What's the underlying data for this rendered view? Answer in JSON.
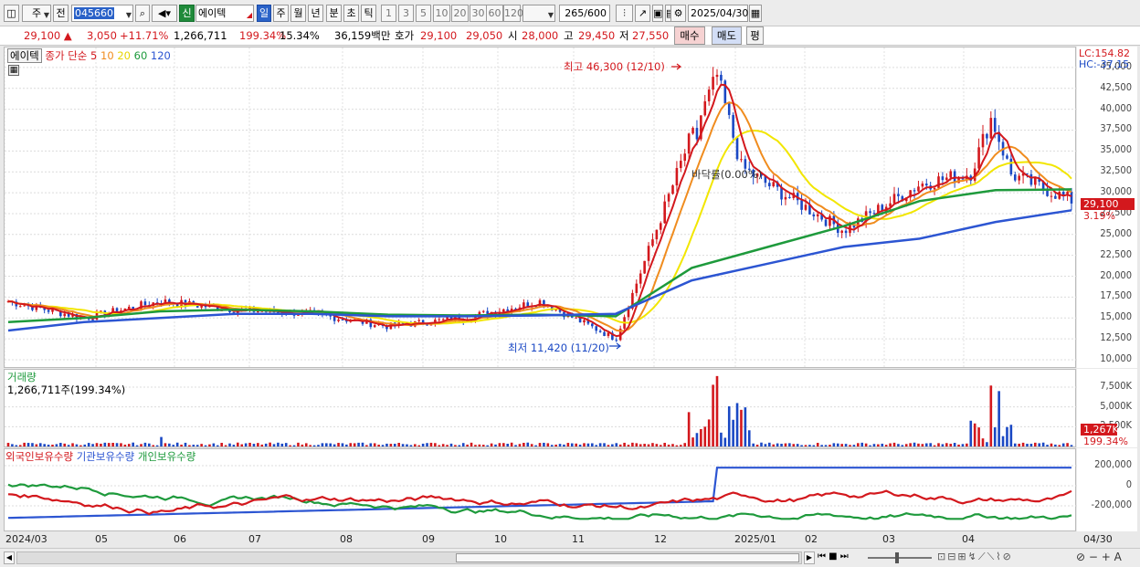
{
  "toolbar": {
    "market": "주",
    "prev": "전",
    "code": "045660",
    "new_badge": "신",
    "name": "에이텍",
    "periods": [
      "일",
      "주",
      "월",
      "년",
      "분",
      "초",
      "틱"
    ],
    "intervals": [
      "1",
      "3",
      "5",
      "10",
      "20",
      "30",
      "60",
      "120"
    ],
    "count": "265",
    "count_max": "/600",
    "date": "2025/04/30"
  },
  "quote": {
    "price": "29,100 ▲",
    "change": "3,050",
    "change_pct": "+11.71%",
    "volume": "1,266,711",
    "volume_ratio": "199.34%",
    "turnover": "15.34%",
    "amount": "36,159백만",
    "hoga_label": "호가",
    "hoga1": "29,100",
    "hoga2": "29,050",
    "open_label": "시",
    "open": "28,000",
    "high_label": "고",
    "high": "29,450",
    "low_label": "저",
    "low": "27,550",
    "buy": "매수",
    "sell": "매도",
    "eval": "평"
  },
  "price_panel": {
    "stock_label": "에이텍",
    "legend_prefix": "종가 단순",
    "ma_labels": [
      "5",
      "10",
      "20",
      "60",
      "120"
    ],
    "lc": "LC:154.82",
    "hc": "HC:-37.15",
    "high_note": "최고 46,300 (12/10)",
    "low_note": "최저 11,420 (11/20)",
    "bttm_note": "바닥률(0.00%)",
    "price_tag": "29,100",
    "pct_tag": "3.19%",
    "y_ticks": [
      "45,000",
      "42,500",
      "40,000",
      "37,500",
      "35,000",
      "32,500",
      "30,000",
      "27,500",
      "25,000",
      "22,500",
      "20,000",
      "17,500",
      "15,000",
      "12,500",
      "10,000"
    ]
  },
  "volume_panel": {
    "title": "거래량",
    "value": "1,266,711주(199.34%)",
    "y_ticks": [
      "7,500K",
      "5,000K",
      "2,500K"
    ],
    "tag_value": "1,267K",
    "tag_pct": "199.34%"
  },
  "holding_panel": {
    "labels": [
      "외국인보유수량",
      "기관보유수량",
      "개인보유수량"
    ],
    "y_ticks": [
      "200,000",
      "0",
      "-200,000"
    ]
  },
  "x_axis": {
    "labels": [
      "2024/03",
      "05",
      "06",
      "07",
      "08",
      "09",
      "10",
      "11",
      "12",
      "2025/01",
      "02",
      "03",
      "04"
    ],
    "end_label": "04/30"
  },
  "colors": {
    "up": "#d3181d",
    "down": "#1a48c4",
    "ma5": "#d3181d",
    "ma10": "#f08c1e",
    "ma20": "#f2e600",
    "ma60": "#1e9a3c",
    "ma120": "#2c55d2"
  },
  "chart_data": {
    "type": "line",
    "ylim": [
      10000,
      46300
    ],
    "x": [
      "2024/03",
      "05",
      "06",
      "07",
      "08",
      "09",
      "10",
      "11",
      "12",
      "2025/01",
      "02",
      "03",
      "04",
      "04/30"
    ],
    "close": [
      17000,
      15000,
      17000,
      16000,
      15500,
      14000,
      15000,
      17000,
      12500,
      37000,
      31000,
      25500,
      31000,
      33000,
      29100
    ],
    "ma120": [
      13500,
      14500,
      15000,
      15500,
      15500,
      15200,
      15200,
      15300,
      15500,
      19500,
      21500,
      23500,
      24500,
      26500,
      27900
    ],
    "ma60": [
      14500,
      15000,
      15800,
      16000,
      15800,
      15400,
      15300,
      15400,
      15200,
      21000,
      23500,
      26000,
      29000,
      30300,
      30400
    ],
    "volume_max_k": 9000,
    "volume_peaks": [
      {
        "label": "12",
        "value_k": 8900
      },
      {
        "label": "04",
        "value_k": 7700
      }
    ]
  }
}
